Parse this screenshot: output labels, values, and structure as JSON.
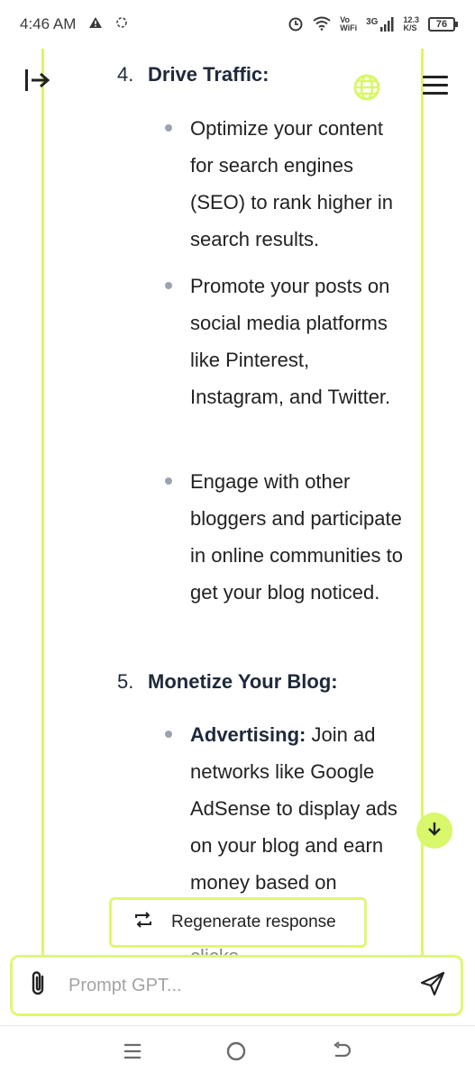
{
  "status_bar": {
    "time": "4:46 AM",
    "vo": "Vo",
    "wifi": "WiFi",
    "network": "3G",
    "speed_value": "12.3",
    "speed_unit": "K/S",
    "battery": "76"
  },
  "content": {
    "step4": {
      "number": "4.",
      "title": "Drive Traffic:"
    },
    "step4_bullets": [
      "Optimize your content for search engines (SEO) to rank higher in search results.",
      "Promote your posts on social media platforms like Pinterest, Instagram, and Twitter.",
      "Engage with other bloggers and participate in online communities to get your blog noticed."
    ],
    "step5": {
      "number": "5.",
      "title": "Monetize Your Blog:"
    },
    "step5_bullet": {
      "bold": "Advertising:",
      "text": "Join ad networks like Google AdSense to display ads on your blog and earn money based on"
    },
    "cut_text": "clicks"
  },
  "regenerate_label": "Regenerate response",
  "input": {
    "placeholder": "Prompt GPT..."
  },
  "colors": {
    "accent": "#dff86f"
  }
}
